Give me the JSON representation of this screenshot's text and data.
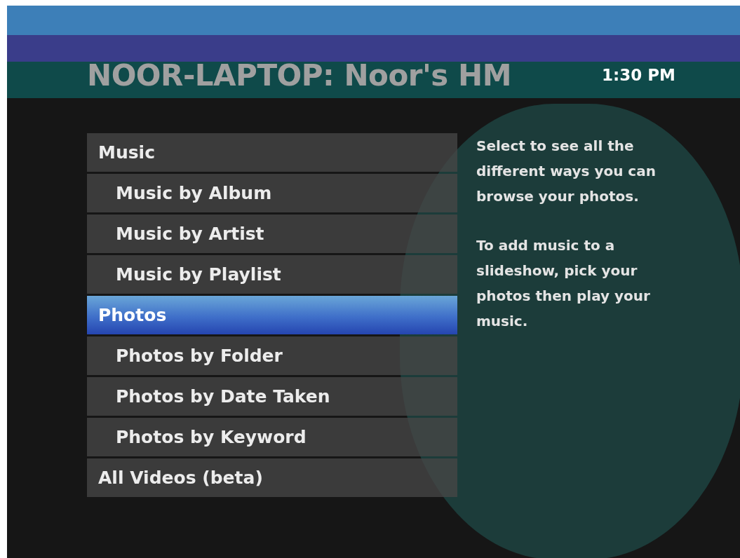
{
  "header": {
    "title": "NOOR-LAPTOP: Noor's HM",
    "time": "1:30 PM"
  },
  "menu": [
    {
      "label": "Music",
      "selected": false,
      "children": [
        {
          "label": "Music by Album",
          "selected": false
        },
        {
          "label": "Music by Artist",
          "selected": false
        },
        {
          "label": "Music by Playlist",
          "selected": false
        }
      ]
    },
    {
      "label": "Photos",
      "selected": true,
      "children": [
        {
          "label": "Photos by Folder",
          "selected": false
        },
        {
          "label": "Photos by Date Taken",
          "selected": false
        },
        {
          "label": "Photos by Keyword",
          "selected": false
        }
      ]
    },
    {
      "label": "All Videos (beta)",
      "selected": false
    }
  ],
  "description": [
    "Select to see all the different ways you can browse your photos.",
    "To add music to a slideshow, pick your photos then play your music."
  ]
}
